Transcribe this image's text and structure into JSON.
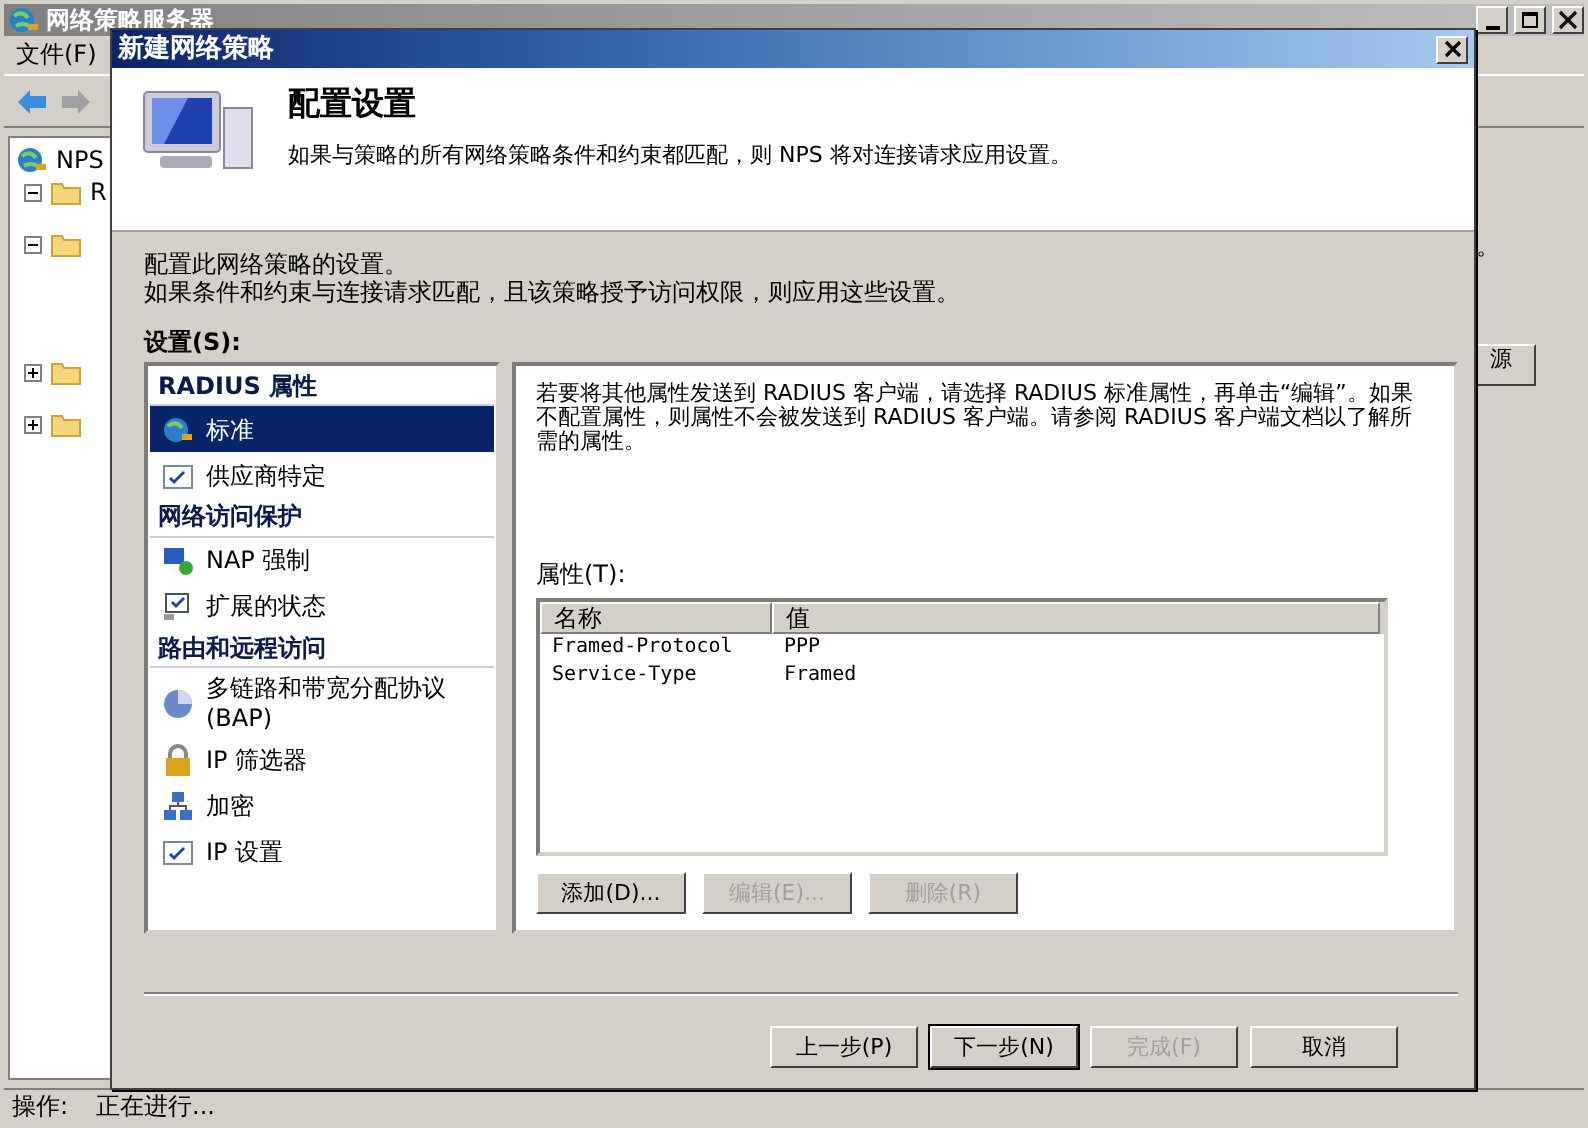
{
  "background_window": {
    "title": "网络策略服务器",
    "menu": [
      "文件(F)"
    ],
    "tree": [
      {
        "label": "NPS",
        "children": [
          {
            "label": "R",
            "expanded": true
          },
          {
            "expanded": true
          },
          {
            "expanded": false
          },
          {
            "expanded": false
          }
        ]
      }
    ],
    "right_pane": {
      "text": "。",
      "column_header": "源"
    },
    "status_bar": {
      "label": "操作:",
      "value": "正在进行..."
    }
  },
  "dialog": {
    "title": "新建网络策略",
    "header_title": "配置设置",
    "header_description": "如果与策略的所有网络策略条件和约束都匹配，则 NPS 将对连接请求应用设置。",
    "intro": [
      "配置此网络策略的设置。",
      "如果条件和约束与连接请求匹配，且该策略授予访问权限，则应用这些设置。"
    ],
    "settings_label": "设置(S):",
    "nav": [
      {
        "kind": "header",
        "label": "RADIUS 属性"
      },
      {
        "kind": "item",
        "label": "标准",
        "selected": true
      },
      {
        "kind": "item",
        "label": "供应商特定",
        "selected": false
      },
      {
        "kind": "header",
        "label": "网络访问保护"
      },
      {
        "kind": "item",
        "label": "NAP 强制",
        "selected": false
      },
      {
        "kind": "item",
        "label": "扩展的状态",
        "selected": false
      },
      {
        "kind": "header",
        "label": "路由和远程访问"
      },
      {
        "kind": "item",
        "label": "多链路和带宽分配协议(BAP)",
        "selected": false
      },
      {
        "kind": "item",
        "label": "IP 筛选器",
        "selected": false
      },
      {
        "kind": "item",
        "label": "加密",
        "selected": false
      },
      {
        "kind": "item",
        "label": "IP 设置",
        "selected": false
      }
    ],
    "description": "若要将其他属性发送到 RADIUS 客户端，请选择 RADIUS 标准属性，再单击“编辑”。如果不配置属性，则属性不会被发送到 RADIUS 客户端。请参阅 RADIUS 客户端文档以了解所需的属性。",
    "attributes_label": "属性(T):",
    "table": {
      "columns": [
        "名称",
        "值"
      ],
      "rows": [
        [
          "Framed-Protocol",
          "PPP"
        ],
        [
          "Service-Type",
          "Framed"
        ]
      ]
    },
    "table_buttons": [
      {
        "label": "添加(D)...",
        "disabled": false
      },
      {
        "label": "编辑(E)...",
        "disabled": true
      },
      {
        "label": "删除(R)",
        "disabled": true
      }
    ],
    "footer_buttons": [
      {
        "label": "上一步(P)",
        "disabled": false,
        "default": false
      },
      {
        "label": "下一步(N)",
        "disabled": false,
        "default": true
      },
      {
        "label": "完成(F)",
        "disabled": true,
        "default": false
      },
      {
        "label": "取消",
        "disabled": false,
        "default": false
      }
    ]
  }
}
